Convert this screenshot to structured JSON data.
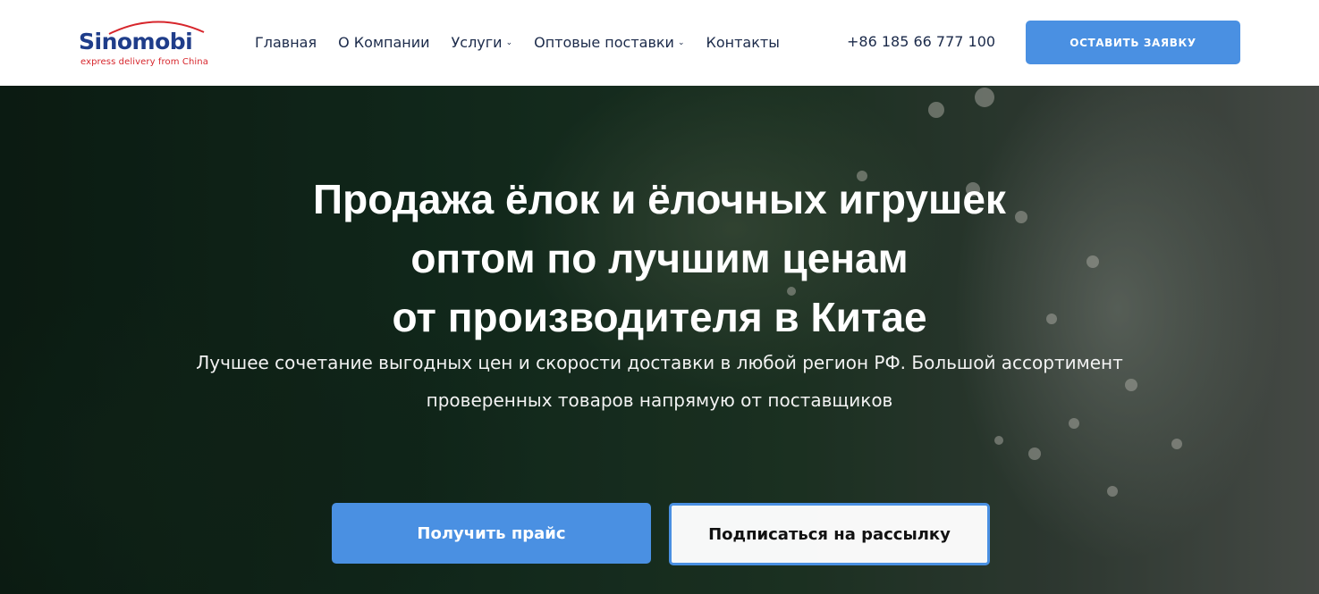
{
  "header": {
    "logo": {
      "name": "Sinomobi",
      "tagline": "express delivery from China",
      "arc_color": "#d7262c"
    },
    "nav": [
      {
        "label": "Главная",
        "dropdown": false
      },
      {
        "label": "О Компании",
        "dropdown": false
      },
      {
        "label": "Услуги",
        "dropdown": true
      },
      {
        "label": "Оптовые поставки",
        "dropdown": true
      },
      {
        "label": "Контакты",
        "dropdown": false
      }
    ],
    "phone": "+86 185 66 777 100",
    "cta_label": "ОСТАВИТЬ ЗАЯВКУ"
  },
  "hero": {
    "title_lines": [
      "Продажа ёлок и ёлочных игрушек",
      "оптом по лучшим ценам",
      "от производителя в Китае"
    ],
    "subtitle_lines": [
      "Лучшее сочетание выгодных цен и скорости доставки в любой регион РФ. Большой ассортимент",
      "проверенных товаров напрямую от поставщиков"
    ],
    "primary_button": "Получить прайс",
    "secondary_button": "Подписаться на рассылку"
  },
  "colors": {
    "accent": "#4a90e2",
    "brand_blue": "#1f3d8a",
    "brand_red": "#d7262c"
  },
  "icons": {
    "nav_dropdown": "chevron-down-icon"
  }
}
